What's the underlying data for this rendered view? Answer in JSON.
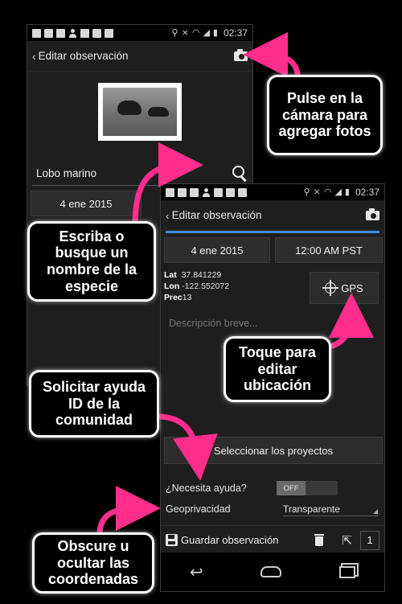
{
  "status_bar": {
    "time": "02:37"
  },
  "screen1": {
    "title": "Editar observación",
    "species": "Lobo marino",
    "date": "4 ene 2015"
  },
  "screen2": {
    "title": "Editar observación",
    "date": "4 ene 2015",
    "time": "12:00 AM PST",
    "lat_label": "Lat",
    "lat": "37.841229",
    "lon_label": "Lon",
    "lon": "-122.552072",
    "prec_label": "Prec",
    "prec": "13",
    "gps_label": "GPS",
    "description_placeholder": "Descripción breve...",
    "projects_button": "Seleccionar los proyectos",
    "help_label": "¿Necesita ayuda?",
    "help_toggle": "OFF",
    "geoprivacy_label": "Geoprivacidad",
    "geoprivacy_value": "Transparente",
    "save_label": "Guardar observación",
    "count": "1"
  },
  "callouts": {
    "camera": "Pulse en la cámara para agregar fotos",
    "species": "Escriba o busque un nombre de la especie",
    "location": "Toque para editar ubicación",
    "help": "Solicitar ayuda ID de la comunidad",
    "geoprivacy": "Obscure u ocultar las coordenadas"
  },
  "colors": {
    "arrow": "#ff2d8c",
    "accent_line": "#3a8bd8"
  }
}
